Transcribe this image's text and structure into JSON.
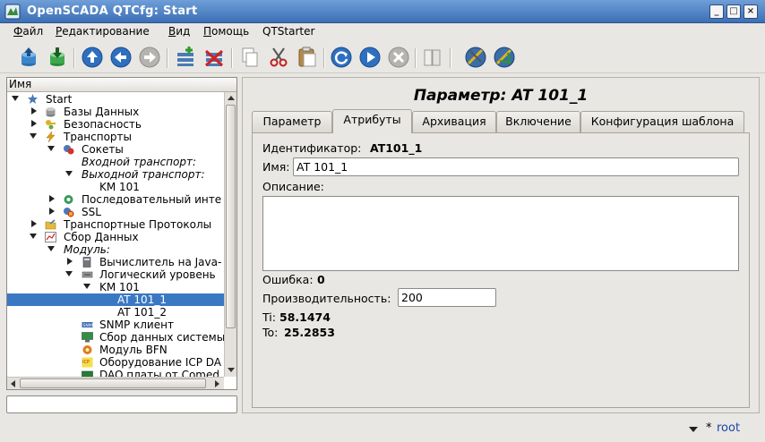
{
  "window": {
    "title": "OpenSCADA QTCfg: Start"
  },
  "menu": [
    {
      "label": "Файл",
      "u": "Ф",
      "rest": "айл"
    },
    {
      "label": "Редактирование",
      "u": "Р",
      "rest": "едактирование"
    },
    {
      "label": "Вид",
      "u": "В",
      "rest": "ид"
    },
    {
      "label": "Помощь",
      "u": "П",
      "rest": "омощь"
    },
    {
      "label": "QTStarter",
      "u": "",
      "rest": "QTStarter"
    }
  ],
  "tree": {
    "header": "Имя",
    "items": [
      {
        "label": "Start",
        "italic": false,
        "selected": false
      },
      {
        "label": "Базы Данных",
        "italic": false,
        "selected": false
      },
      {
        "label": "Безопасность",
        "italic": false,
        "selected": false
      },
      {
        "label": "Транспорты",
        "italic": false,
        "selected": false
      },
      {
        "label": "Сокеты",
        "italic": false,
        "selected": false
      },
      {
        "label": "Входной транспорт:",
        "italic": true,
        "selected": false
      },
      {
        "label": "Выходной транспорт:",
        "italic": true,
        "selected": false
      },
      {
        "label": "KM 101",
        "italic": false,
        "selected": false
      },
      {
        "label": "Последовательный инте",
        "italic": false,
        "selected": false
      },
      {
        "label": "SSL",
        "italic": false,
        "selected": false
      },
      {
        "label": "Транспортные Протоколы",
        "italic": false,
        "selected": false
      },
      {
        "label": "Сбор Данных",
        "italic": false,
        "selected": false
      },
      {
        "label": "Модуль:",
        "italic": true,
        "selected": false
      },
      {
        "label": "Вычислитель на Java-",
        "italic": false,
        "selected": false
      },
      {
        "label": "Логический уровень",
        "italic": false,
        "selected": false
      },
      {
        "label": "KM 101",
        "italic": false,
        "selected": false
      },
      {
        "label": "AT 101_1",
        "italic": false,
        "selected": true
      },
      {
        "label": "AT 101_2",
        "italic": false,
        "selected": false
      },
      {
        "label": "SNMP клиент",
        "italic": false,
        "selected": false
      },
      {
        "label": "Сбор данных системы",
        "italic": false,
        "selected": false
      },
      {
        "label": "Модуль BFN",
        "italic": false,
        "selected": false
      },
      {
        "label": "Оборудование ICP DA",
        "italic": false,
        "selected": false
      },
      {
        "label": "DAQ платы от Comed",
        "italic": false,
        "selected": false
      }
    ]
  },
  "param": {
    "title": "Параметр: AT 101_1",
    "tabs": [
      "Параметр",
      "Атрибуты",
      "Архивация",
      "Включение",
      "Конфигурация шаблона"
    ],
    "active_tab": "Атрибуты",
    "id_label": "Идентификатор:",
    "id_value": "AT101_1",
    "name_label": "Имя:",
    "name_value": "AT 101_1",
    "descr_label": "Описание:",
    "descr_value": "",
    "error_label": "Ошибка:",
    "error_value": "0",
    "perf_label": "Производительность:",
    "perf_value": "200",
    "ti_label": "Ti:",
    "ti_value": "58.1474",
    "to_label": "To:",
    "to_value": "25.2853"
  },
  "status": {
    "star": "*",
    "user": "root"
  },
  "colors": {
    "selection": "#3a78c4",
    "title_bar": "#3c6fb5",
    "user": "#1846a8"
  }
}
